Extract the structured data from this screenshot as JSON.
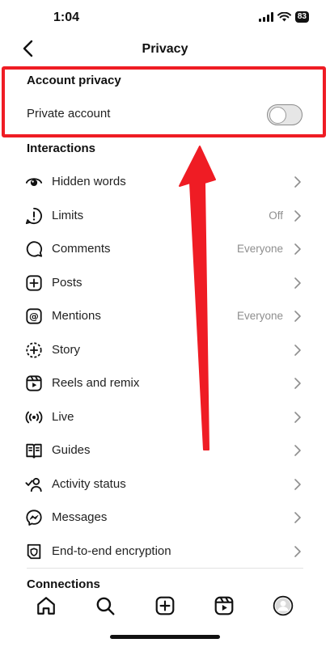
{
  "status_bar": {
    "time": "1:04",
    "battery": "83"
  },
  "header": {
    "title": "Privacy"
  },
  "account_privacy": {
    "section_title": "Account privacy",
    "private_account_label": "Private account",
    "private_account_enabled": false
  },
  "interactions": {
    "section_title": "Interactions",
    "items": [
      {
        "label": "Hidden words",
        "value": "",
        "icon": "eye-icon"
      },
      {
        "label": "Limits",
        "value": "Off",
        "icon": "limits-icon"
      },
      {
        "label": "Comments",
        "value": "Everyone",
        "icon": "comment-icon"
      },
      {
        "label": "Posts",
        "value": "",
        "icon": "plus-square-icon"
      },
      {
        "label": "Mentions",
        "value": "Everyone",
        "icon": "at-icon"
      },
      {
        "label": "Story",
        "value": "",
        "icon": "story-icon"
      },
      {
        "label": "Reels and remix",
        "value": "",
        "icon": "reels-icon"
      },
      {
        "label": "Live",
        "value": "",
        "icon": "live-icon"
      },
      {
        "label": "Guides",
        "value": "",
        "icon": "guides-icon"
      },
      {
        "label": "Activity status",
        "value": "",
        "icon": "activity-status-icon"
      },
      {
        "label": "Messages",
        "value": "",
        "icon": "messenger-icon"
      },
      {
        "label": "End-to-end encryption",
        "value": "",
        "icon": "encryption-icon"
      }
    ]
  },
  "connections": {
    "section_title": "Connections"
  },
  "tab_bar": {
    "tabs": [
      "home-icon",
      "search-icon",
      "create-icon",
      "reels-icon",
      "profile-icon"
    ]
  },
  "annotation": {
    "highlight_color": "#ef1c24",
    "arrow_color": "#ef1c24"
  }
}
